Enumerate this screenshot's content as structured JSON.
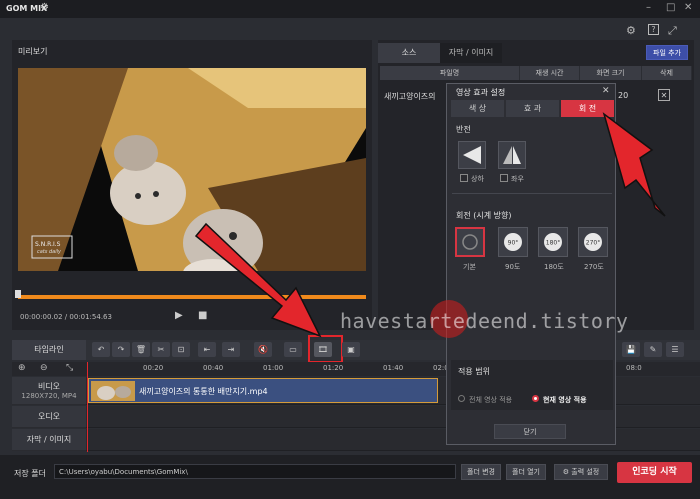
{
  "app": {
    "title": "GOM MIX"
  },
  "preview": {
    "label": "미리보기",
    "time_display": "00:00:00.02 / 00:01:54.63",
    "video_logo_line1": "S.N.R.I.S",
    "video_logo_line2": "cats daily"
  },
  "source_panel": {
    "tabs": [
      "소스",
      "자막 / 이미지"
    ],
    "add_file_label": "파일 추가",
    "columns": [
      "파일명",
      "재생 시간",
      "화면 크기",
      "삭제"
    ],
    "row_file": "새끼고양이즈의",
    "row_size_partial": "20"
  },
  "dialog": {
    "title": "영상 효과 설정",
    "tabs": [
      "색 상",
      "효 과",
      "회 전"
    ],
    "flip_section": "반전",
    "flip_options": [
      "상하",
      "좌우"
    ],
    "rotate_section": "회전 (시계 방향)",
    "rotate_options": [
      "기본",
      "90도",
      "180도",
      "270도"
    ],
    "rotate_icon_labels": [
      "90°",
      "180°",
      "270°"
    ],
    "apply_section": "적용 범위",
    "apply_options": [
      "전체 영상 적용",
      "현재 영상 적용"
    ],
    "close_label": "닫기"
  },
  "timeline": {
    "label": "타임라인",
    "ruler": [
      "00:20",
      "00:40",
      "01:00",
      "01:20",
      "01:40",
      "02:0"
    ],
    "ruler_right": "08:0",
    "tracks": {
      "video": "비디오",
      "video_info": "1280X720, MP4",
      "audio": "오디오",
      "subtitle": "자막 / 이미지"
    },
    "clip_name": "새끼고양이즈의 통통한 배만지기.mp4"
  },
  "footer": {
    "save_folder_label": "저장 폴더",
    "save_path": "C:\\Users\\oyabu\\Documents\\GomMix\\",
    "change_folder": "폴더 변경",
    "open_folder": "폴더 열기",
    "output_settings": "출력 설정",
    "encode_start": "인코딩 시작"
  },
  "watermark": "havestartedeend.tistory",
  "colors": {
    "accent_red": "#d73542",
    "seek_orange": "#f08a1c",
    "clip_blue": "#3b5080"
  }
}
